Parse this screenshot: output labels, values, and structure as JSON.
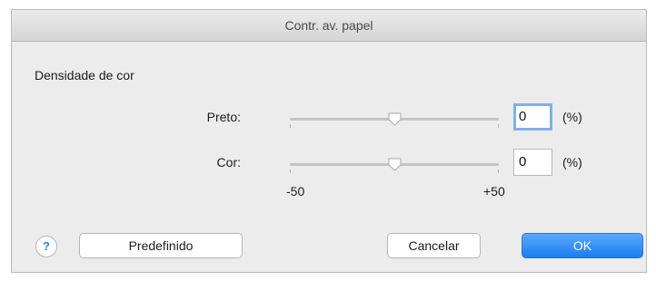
{
  "window": {
    "title": "Contr. av. papel"
  },
  "section": {
    "label": "Densidade de cor"
  },
  "rows": [
    {
      "label": "Preto:",
      "value": "0",
      "unit": "(%)",
      "slider_value": 0
    },
    {
      "label": "Cor:",
      "value": "0",
      "unit": "(%)",
      "slider_value": 0
    }
  ],
  "scale": {
    "min_label": "-50",
    "max_label": "+50"
  },
  "buttons": {
    "help": "?",
    "defaults": "Predefinido",
    "cancel": "Cancelar",
    "ok": "OK"
  },
  "colors": {
    "accent": "#1a7ef1",
    "focus_ring": "#7fb0ea",
    "window_bg": "#ececec"
  }
}
